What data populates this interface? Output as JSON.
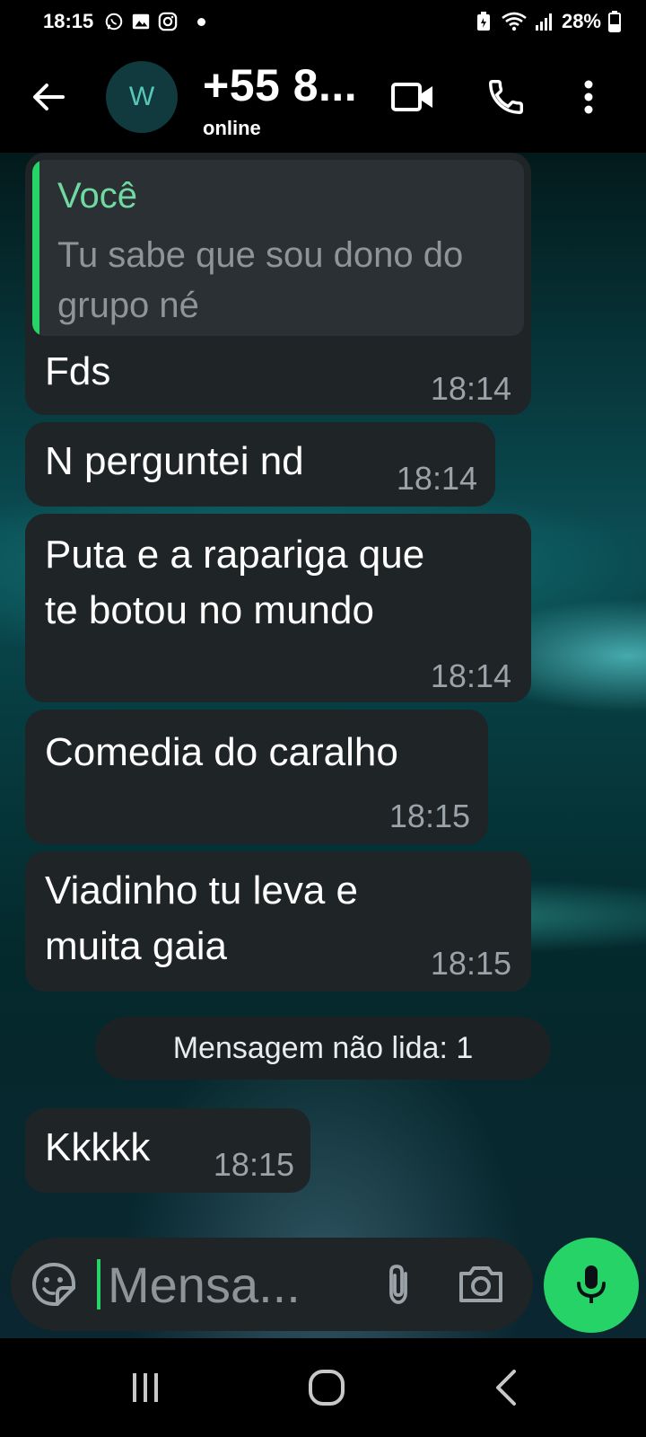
{
  "status_bar": {
    "time": "18:15",
    "battery": "28%",
    "left_icons": [
      "whatsapp-icon",
      "gallery-icon",
      "instagram-icon",
      "notification-dot"
    ],
    "right_icons": [
      "battery-saver-icon",
      "wifi-icon",
      "signal-icon",
      "battery-icon"
    ]
  },
  "header": {
    "avatar_initial": "W",
    "contact_name": "+55 8...",
    "status": "online",
    "icons": [
      "back-arrow-icon",
      "video-call-icon",
      "voice-call-icon",
      "more-vert-icon"
    ]
  },
  "messages": [
    {
      "quote": {
        "author": "Você",
        "text": "Tu sabe que sou dono do grupo né"
      },
      "text": "Fds",
      "time": "18:14"
    },
    {
      "text": "N perguntei nd",
      "time": "18:14"
    },
    {
      "lines": [
        "Puta e a rapariga que",
        "te botou no mundo"
      ],
      "time": "18:14"
    },
    {
      "text": "Comedia do caralho",
      "time": "18:15"
    },
    {
      "lines": [
        "Viadinho tu leva e",
        "muita gaia"
      ],
      "time": "18:15"
    },
    {
      "text": "Kkkkk",
      "time": "18:15"
    }
  ],
  "unread_divider": "Mensagem não lida: 1",
  "composer": {
    "placeholder": "Mensa...",
    "value": "",
    "icons": [
      "emoji-icon",
      "attach-icon",
      "camera-icon",
      "mic-icon"
    ]
  },
  "colors": {
    "accent_green": "#25d366",
    "bubble_bg": "#1f2427",
    "quote_author": "#70d9a0",
    "timestamp": "#9aa3a7"
  },
  "nav": [
    "recent-apps-icon",
    "home-icon",
    "back-icon"
  ]
}
